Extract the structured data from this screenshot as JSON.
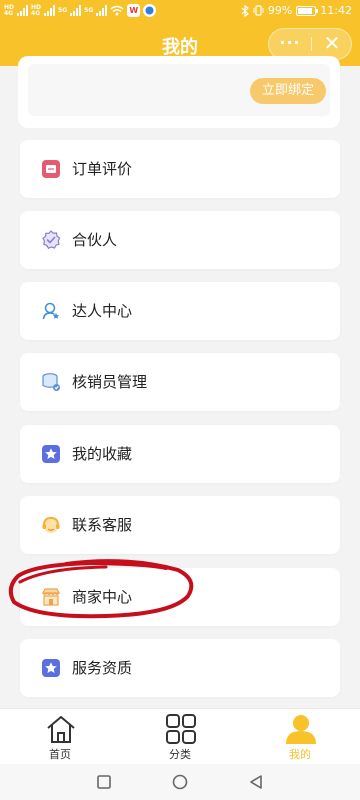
{
  "status_bar": {
    "left_tags": [
      "HD",
      "4G",
      "HD",
      "4G",
      "5G",
      "5G"
    ],
    "app_badge_1": "W",
    "battery": "99%",
    "time": "11:42"
  },
  "header": {
    "title": "我的",
    "more_glyph": "···",
    "close_glyph": "✕"
  },
  "bind_card": {
    "button": "立即绑定"
  },
  "menu": {
    "items": [
      {
        "label": "订单评价",
        "icon": "review-icon",
        "color": "#e55a6e"
      },
      {
        "label": "合伙人",
        "icon": "badge-check-icon",
        "color": "#8c7bd4"
      },
      {
        "label": "达人中心",
        "icon": "expert-icon",
        "color": "#3a8fdc"
      },
      {
        "label": "核销员管理",
        "icon": "coins-stack-icon",
        "color": "#5b8fd8"
      },
      {
        "label": "我的收藏",
        "icon": "star-icon",
        "color": "#5b6fe0"
      },
      {
        "label": "联系客服",
        "icon": "headset-icon",
        "color": "#f2b23a"
      },
      {
        "label": "商家中心",
        "icon": "shop-icon",
        "color": "#f0a24a"
      },
      {
        "label": "服务资质",
        "icon": "star-icon",
        "color": "#5b6fe0"
      }
    ]
  },
  "tabbar": {
    "tabs": [
      {
        "label": "首页",
        "icon": "home-icon"
      },
      {
        "label": "分类",
        "icon": "grid-icon"
      },
      {
        "label": "我的",
        "icon": "user-icon",
        "active": true
      }
    ],
    "active_color": "#f7c22a"
  },
  "colors": {
    "brand": "#f7c22a",
    "annotation": "#c60f1c"
  }
}
